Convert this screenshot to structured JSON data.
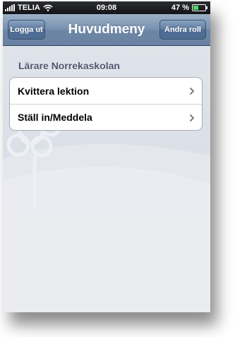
{
  "status_bar": {
    "carrier": "TELIA",
    "time": "09:08",
    "battery": "47 %",
    "battery_level": 0.47
  },
  "nav_bar": {
    "title": "Huvudmeny",
    "left_button": "Logga ut",
    "right_button": "Ändra roll"
  },
  "section": {
    "header": "Lärare Norrekaskolan",
    "items": [
      {
        "label": "Kvittera lektion",
        "icon": "chevron-right-icon"
      },
      {
        "label": "Ställ in/Meddela",
        "icon": "chevron-right-icon"
      }
    ]
  },
  "colors": {
    "navbar": "#7890ae",
    "background": "#dfe3ea"
  }
}
